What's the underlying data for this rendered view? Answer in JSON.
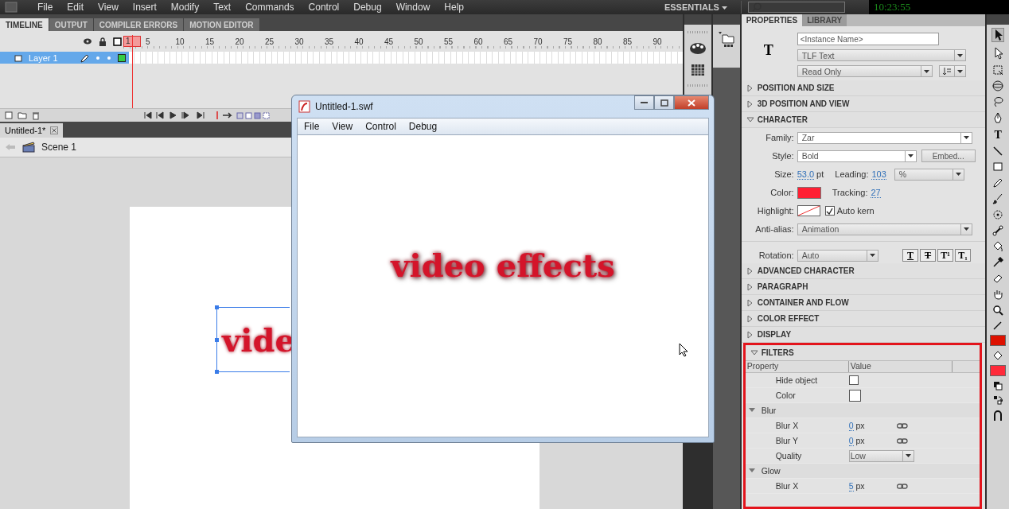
{
  "menu_bar": {
    "items": [
      "File",
      "Edit",
      "View",
      "Insert",
      "Modify",
      "Text",
      "Commands",
      "Control",
      "Debug",
      "Window",
      "Help"
    ],
    "workspace": "ESSENTIALS",
    "clock": "10:23:55"
  },
  "timeline_panel": {
    "tabs": [
      {
        "label": "TIMELINE",
        "selected": true
      },
      {
        "label": "OUTPUT",
        "selected": false
      },
      {
        "label": "COMPILER ERRORS",
        "selected": false
      },
      {
        "label": "MOTION EDITOR",
        "selected": false
      }
    ],
    "frame_numbers": [
      "1",
      "5",
      "10",
      "15",
      "20",
      "25",
      "30",
      "35",
      "40",
      "45",
      "50",
      "55",
      "60",
      "65",
      "70",
      "75",
      "80",
      "85",
      "90"
    ],
    "layers": [
      {
        "name": "Layer 1",
        "selected": true
      }
    ]
  },
  "document": {
    "tab": "Untitled-1*",
    "scene": "Scene 1",
    "stage_text": "vide"
  },
  "player_window": {
    "title": "Untitled-1.swf",
    "menu": [
      "File",
      "View",
      "Control",
      "Debug"
    ],
    "content_text": "video effects"
  },
  "properties": {
    "tabs": [
      {
        "label": "PROPERTIES",
        "selected": true
      },
      {
        "label": "LIBRARY",
        "selected": false
      }
    ],
    "type_glyph": "T",
    "instance_placeholder": "<Instance Name>",
    "text_type": "TLF Text",
    "text_mode": "Read Only",
    "sections_before": [
      {
        "title": "POSITION AND SIZE",
        "expanded": false
      },
      {
        "title": "3D POSITION AND VIEW",
        "expanded": false
      },
      {
        "title": "CHARACTER",
        "expanded": true
      }
    ],
    "character": {
      "family_label": "Family:",
      "family": "Zar",
      "style_label": "Style:",
      "style": "Bold",
      "embed_button": "Embed...",
      "size_label": "Size:",
      "size": "53.0",
      "size_unit": "pt",
      "leading_label": "Leading:",
      "leading": "103",
      "leading_unit": "%",
      "color_label": "Color:",
      "color": "#ff1f33",
      "tracking_label": "Tracking:",
      "tracking": "27",
      "highlight_label": "Highlight:",
      "auto_kern": {
        "label": "Auto kern",
        "checked": true
      },
      "anti_alias_label": "Anti-alias:",
      "anti_alias": "Animation",
      "rotation_label": "Rotation:",
      "rotation": "Auto",
      "style_buttons": [
        {
          "label": "T",
          "kind": "underline"
        },
        {
          "label": "T",
          "kind": "strike"
        },
        {
          "label": "T¹",
          "kind": "superscript"
        },
        {
          "label": "T₁",
          "kind": "subscript"
        }
      ]
    },
    "sections_after": [
      {
        "title": "ADVANCED CHARACTER",
        "expanded": false
      },
      {
        "title": "PARAGRAPH",
        "expanded": false
      },
      {
        "title": "CONTAINER AND FLOW",
        "expanded": false
      },
      {
        "title": "COLOR EFFECT",
        "expanded": false
      },
      {
        "title": "DISPLAY",
        "expanded": false
      }
    ],
    "filters": {
      "title": "FILTERS",
      "expanded": true,
      "columns": [
        "Property",
        "Value"
      ],
      "rows": [
        {
          "kind": "checkbox",
          "label": "Hide object",
          "checked": false
        },
        {
          "kind": "swatch",
          "label": "Color",
          "color": "#ffffff"
        },
        {
          "kind": "group",
          "label": "Blur",
          "expanded": true
        },
        {
          "kind": "number",
          "label": "Blur X",
          "value": "0",
          "unit": "px"
        },
        {
          "kind": "number",
          "label": "Blur Y",
          "value": "0",
          "unit": "px"
        },
        {
          "kind": "dropdown",
          "label": "Quality",
          "value": "Low"
        },
        {
          "kind": "group",
          "label": "Glow",
          "expanded": true
        },
        {
          "kind": "number",
          "label": "Blur X",
          "value": "5",
          "unit": "px"
        }
      ]
    }
  },
  "tools": {
    "text_tool": "T"
  }
}
